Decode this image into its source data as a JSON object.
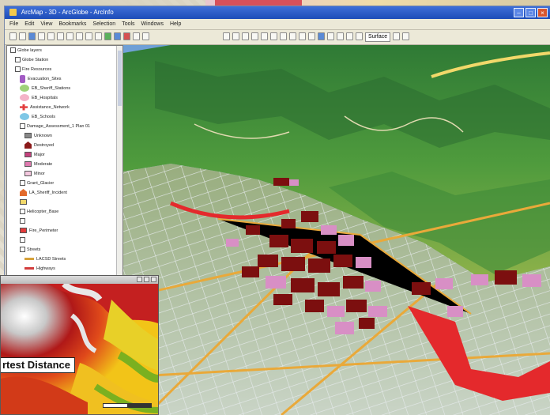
{
  "window": {
    "title": "ArcMap - 3D - ArcGlobe - ArcInfo",
    "controls": [
      "–",
      "□",
      "×"
    ]
  },
  "menu": [
    "File",
    "Edit",
    "View",
    "Bookmarks",
    "Selection",
    "Tools",
    "Windows",
    "Help"
  ],
  "toolbar": {
    "dropdown_value": "Surface"
  },
  "toc": {
    "items": [
      {
        "label": "Globe layers",
        "indent": 4,
        "symbol": "none",
        "symbol_color": ""
      },
      {
        "label": "Globe Station",
        "indent": 10,
        "symbol": "none",
        "symbol_color": ""
      },
      {
        "label": "Fire Resources",
        "indent": 10,
        "symbol": "none",
        "symbol_color": ""
      },
      {
        "label": "Evacuation_Sites",
        "indent": 16,
        "symbol": "pin",
        "symbol_color": "#a25bc4"
      },
      {
        "label": "EB_Sheriff_Stations",
        "indent": 16,
        "symbol": "round",
        "symbol_color": "#9fd27a"
      },
      {
        "label": "EB_Hospitals",
        "indent": 16,
        "symbol": "round",
        "symbol_color": "#f4b3c8"
      },
      {
        "label": "Assistance_Network",
        "indent": 16,
        "symbol": "cross",
        "symbol_color": "#e23c3c"
      },
      {
        "label": "EB_Schools",
        "indent": 16,
        "symbol": "cloud",
        "symbol_color": "#7fc7e6"
      },
      {
        "label": "Damage_Assessment_1 Plan 01",
        "indent": 16,
        "symbol": "none",
        "symbol_color": ""
      },
      {
        "label": "Unknown",
        "indent": 22,
        "symbol": "swatch",
        "symbol_color": "#888888"
      },
      {
        "label": "Destroyed",
        "indent": 22,
        "symbol": "house",
        "symbol_color": "#8b1a1a"
      },
      {
        "label": "Major",
        "indent": 22,
        "symbol": "swatch",
        "symbol_color": "#c4417d"
      },
      {
        "label": "Moderate",
        "indent": 22,
        "symbol": "swatch",
        "symbol_color": "#e07ab0"
      },
      {
        "label": "Minor",
        "indent": 22,
        "symbol": "swatch",
        "symbol_color": "#f3c7de"
      },
      {
        "label": "Grant_Glacier",
        "indent": 16,
        "symbol": "none",
        "symbol_color": ""
      },
      {
        "label": "LA_Sheriff_Incident",
        "indent": 16,
        "symbol": "house",
        "symbol_color": "#e26a2c"
      },
      {
        "label": "",
        "indent": 16,
        "symbol": "swatch",
        "symbol_color": "#f1d86a"
      },
      {
        "label": "Helicopter_Base",
        "indent": 16,
        "symbol": "none",
        "symbol_color": ""
      },
      {
        "label": "",
        "indent": 16,
        "symbol": "none",
        "symbol_color": ""
      },
      {
        "label": "Fire_Perimeter",
        "indent": 16,
        "symbol": "swatch",
        "symbol_color": "#e33b3b"
      },
      {
        "label": "",
        "indent": 16,
        "symbol": "none",
        "symbol_color": ""
      },
      {
        "label": "Streets",
        "indent": 16,
        "symbol": "none",
        "symbol_color": ""
      },
      {
        "label": "LACSD Streets",
        "indent": 22,
        "symbol": "line",
        "symbol_color": "#d6a23a"
      },
      {
        "label": "Highways",
        "indent": 22,
        "symbol": "line",
        "symbol_color": "#d33c3c"
      },
      {
        "label": "Major Roads",
        "indent": 22,
        "symbol": "line",
        "symbol_color": "#e5a52b",
        "selected": true
      },
      {
        "label": "",
        "indent": 22,
        "symbol": "none",
        "symbol_color": ""
      }
    ]
  },
  "inset": {
    "label": "rtest Distance"
  },
  "colors": {
    "title_bar": "#1d4cb8",
    "terrain_green": "#3f8a3a",
    "destroyed": "#7c0f0f",
    "damaged": "#d88fc5",
    "roads": "#e9a93a",
    "fire": "#e4292c"
  }
}
